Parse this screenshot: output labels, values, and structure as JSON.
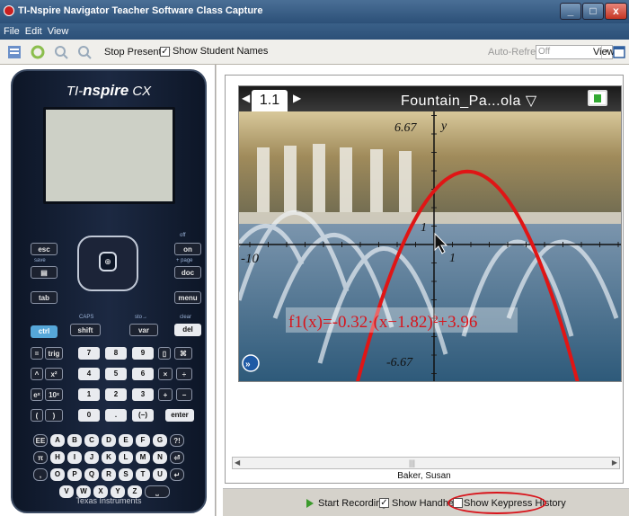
{
  "window": {
    "title": "TI-Nspire Navigator Teacher Software Class Capture",
    "minimize": "_",
    "maximize": "□",
    "close": "x"
  },
  "menu": [
    "File",
    "Edit",
    "View"
  ],
  "toolbar": {
    "stop_presenter": "Stop Presenter",
    "show_student_names": "Show Student Names",
    "show_student_names_checked": true,
    "auto_refresh_label": "Auto-Refresh:",
    "auto_refresh_value": "Off",
    "view_label": "View"
  },
  "calculator": {
    "brand_prefix": "TI-",
    "brand_name": "nspire",
    "brand_suffix": "CX",
    "maker": "Texas Instruments",
    "top_labels": [
      "esc",
      "save",
      "tab",
      "off",
      "on",
      "+ page",
      "doc",
      "menu",
      "ctrl",
      "shift",
      "var",
      "del",
      "clear",
      "CAPS",
      "sto→"
    ],
    "num_keys": [
      "7",
      "8",
      "9",
      "4",
      "5",
      "6",
      "1",
      "2",
      "3",
      "0",
      ".",
      "(−)",
      "enter"
    ],
    "op_keys": [
      "=",
      "trig",
      "^",
      "x²",
      "eˣ",
      "10ˣ",
      "(",
      ")",
      "×",
      "÷",
      "+",
      "−"
    ],
    "letter_rows": [
      [
        "EE",
        "A",
        "B",
        "C",
        "D",
        "E",
        "F",
        "G",
        "?!"
      ],
      [
        "π",
        "H",
        "I",
        "J",
        "K",
        "L",
        "M",
        "N",
        "⏎"
      ],
      [
        ",",
        "O",
        "P",
        "Q",
        "R",
        "S",
        "T",
        "U",
        "↵"
      ],
      [
        "V",
        "W",
        "X",
        "Y",
        "Z",
        "⎵"
      ]
    ]
  },
  "document": {
    "tab_label": "1.1",
    "title": "Fountain_Pa...ola",
    "graph": {
      "function_label": "f1(x)=-0.32·(x−1.82)²+3.96",
      "y_max_label": "6.67",
      "y_min_label": "-6.67",
      "x_min_label": "-10",
      "x_one_label": "1",
      "y_one_label": "1",
      "y_axis_label": "y"
    }
  },
  "student_name": "Baker, Susan",
  "bottombar": {
    "start_recording": "Start Recording",
    "show_handheld": "Show Handheld",
    "show_handheld_checked": true,
    "show_keypress_history": "Show Keypress History",
    "show_keypress_history_checked": false
  },
  "colors": {
    "curve": "#e01515",
    "title_bar": "#2c5078",
    "highlight": "#d8141b"
  }
}
